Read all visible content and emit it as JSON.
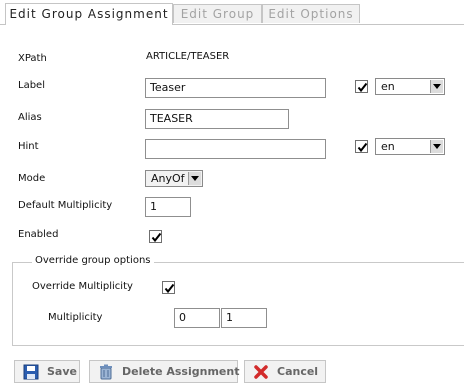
{
  "tabs": [
    {
      "label": "Edit Group Assignment",
      "active": true
    },
    {
      "label": "Edit Group",
      "active": false
    },
    {
      "label": "Edit Options",
      "active": false
    }
  ],
  "form": {
    "xpath": {
      "label": "XPath",
      "value": "ARTICLE/TEASER"
    },
    "label": {
      "label": "Label",
      "value": "Teaser",
      "checked": true,
      "lang": "en"
    },
    "alias": {
      "label": "Alias",
      "value": "TEASER"
    },
    "hint": {
      "label": "Hint",
      "value": "",
      "checked": true,
      "lang": "en"
    },
    "mode": {
      "label": "Mode",
      "value": "AnyOf"
    },
    "default_multiplicity": {
      "label": "Default Multiplicity",
      "value": "1"
    },
    "enabled": {
      "label": "Enabled",
      "checked": true
    }
  },
  "override": {
    "legend": "Override group options",
    "override_multiplicity": {
      "label": "Override Multiplicity",
      "checked": true
    },
    "multiplicity": {
      "label": "Multiplicity",
      "min": "0",
      "max": "1"
    }
  },
  "buttons": {
    "save": "Save",
    "delete": "Delete Assignment",
    "cancel": "Cancel"
  },
  "colors": {
    "check": "#000000",
    "cancel_icon": "#d22b2b",
    "save_icon": "#2a5db0"
  }
}
